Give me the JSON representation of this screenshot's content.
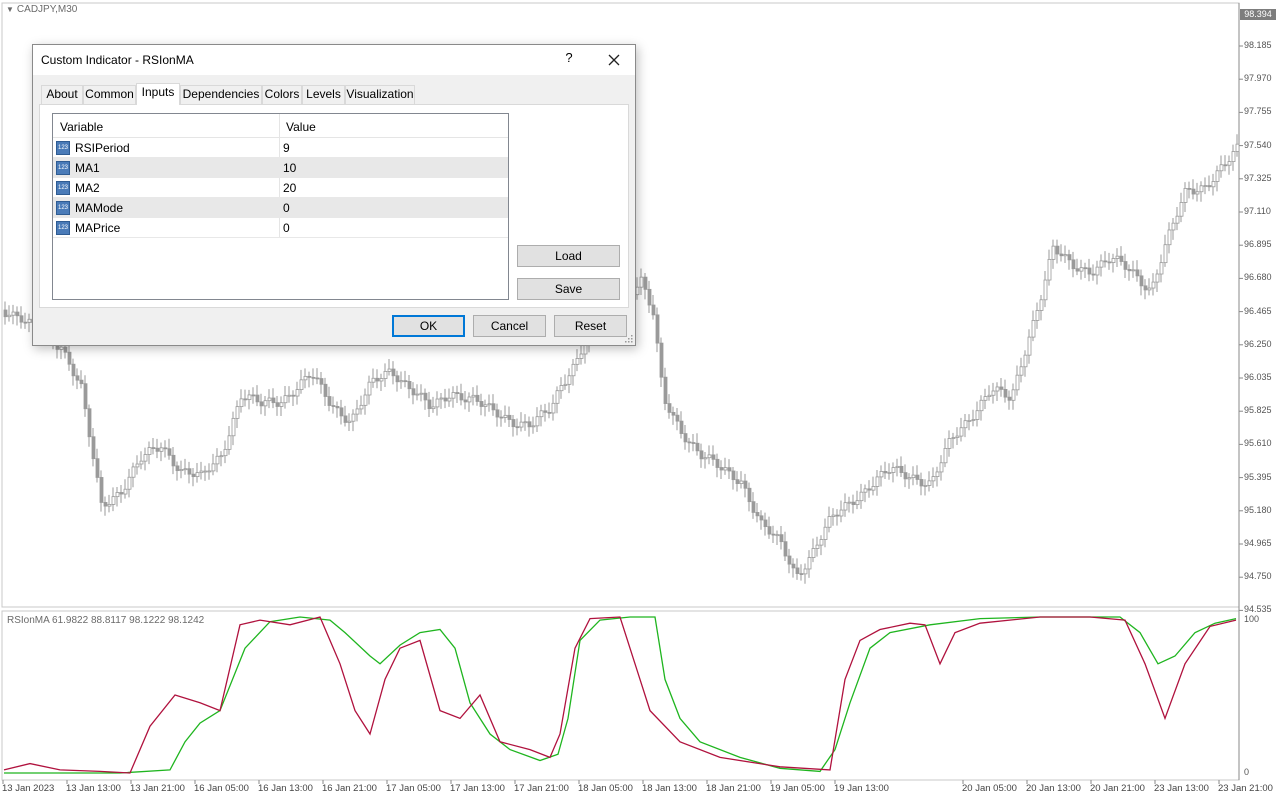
{
  "chart": {
    "symbol_label": "CADJPY,M30",
    "current_price": "98.394",
    "price_ticks": [
      "98.185",
      "97.970",
      "97.755",
      "97.540",
      "97.325",
      "97.110",
      "96.895",
      "96.680",
      "96.465",
      "96.250",
      "96.035",
      "95.825",
      "95.610",
      "95.395",
      "95.180",
      "94.965",
      "94.750",
      "94.535"
    ],
    "indicator_label": "RSIonMA 61.9822 88.8117 98.1222 98.1242",
    "indicator_ticks": [
      "100",
      "0"
    ],
    "time_ticks": [
      "13 Jan 2023",
      "13 Jan 13:00",
      "13 Jan 21:00",
      "16 Jan 05:00",
      "16 Jan 13:00",
      "16 Jan 21:00",
      "17 Jan 05:00",
      "17 Jan 13:00",
      "17 Jan 21:00",
      "18 Jan 05:00",
      "18 Jan 13:00",
      "18 Jan 21:00",
      "19 Jan 05:00",
      "19 Jan 13:00",
      "20 Jan 05:00",
      "20 Jan 13:00",
      "20 Jan 21:00",
      "23 Jan 13:00",
      "23 Jan 21:00"
    ],
    "colors": {
      "candle": "#9a9a9a",
      "line_fast": "#b0123e",
      "line_slow": "#1fb51f",
      "grid": "#c8c8c8"
    }
  },
  "dialog": {
    "title": "Custom Indicator - RSIonMA",
    "help_label": "?",
    "close_icon": "close-x-icon",
    "tabs": [
      "About",
      "Common",
      "Inputs",
      "Dependencies",
      "Colors",
      "Levels",
      "Visualization"
    ],
    "active_tab": "Inputs",
    "grid": {
      "col_variable": "Variable",
      "col_value": "Value",
      "row_icon": "integer-123-icon",
      "icon_text": "123",
      "rows": [
        {
          "name": "RSIPeriod",
          "value": "9"
        },
        {
          "name": "MA1",
          "value": "10"
        },
        {
          "name": "MA2",
          "value": "20"
        },
        {
          "name": "MAMode",
          "value": "0"
        },
        {
          "name": "MAPrice",
          "value": "0"
        }
      ]
    },
    "buttons": {
      "load": "Load",
      "save": "Save",
      "ok": "OK",
      "cancel": "Cancel",
      "reset": "Reset"
    }
  }
}
